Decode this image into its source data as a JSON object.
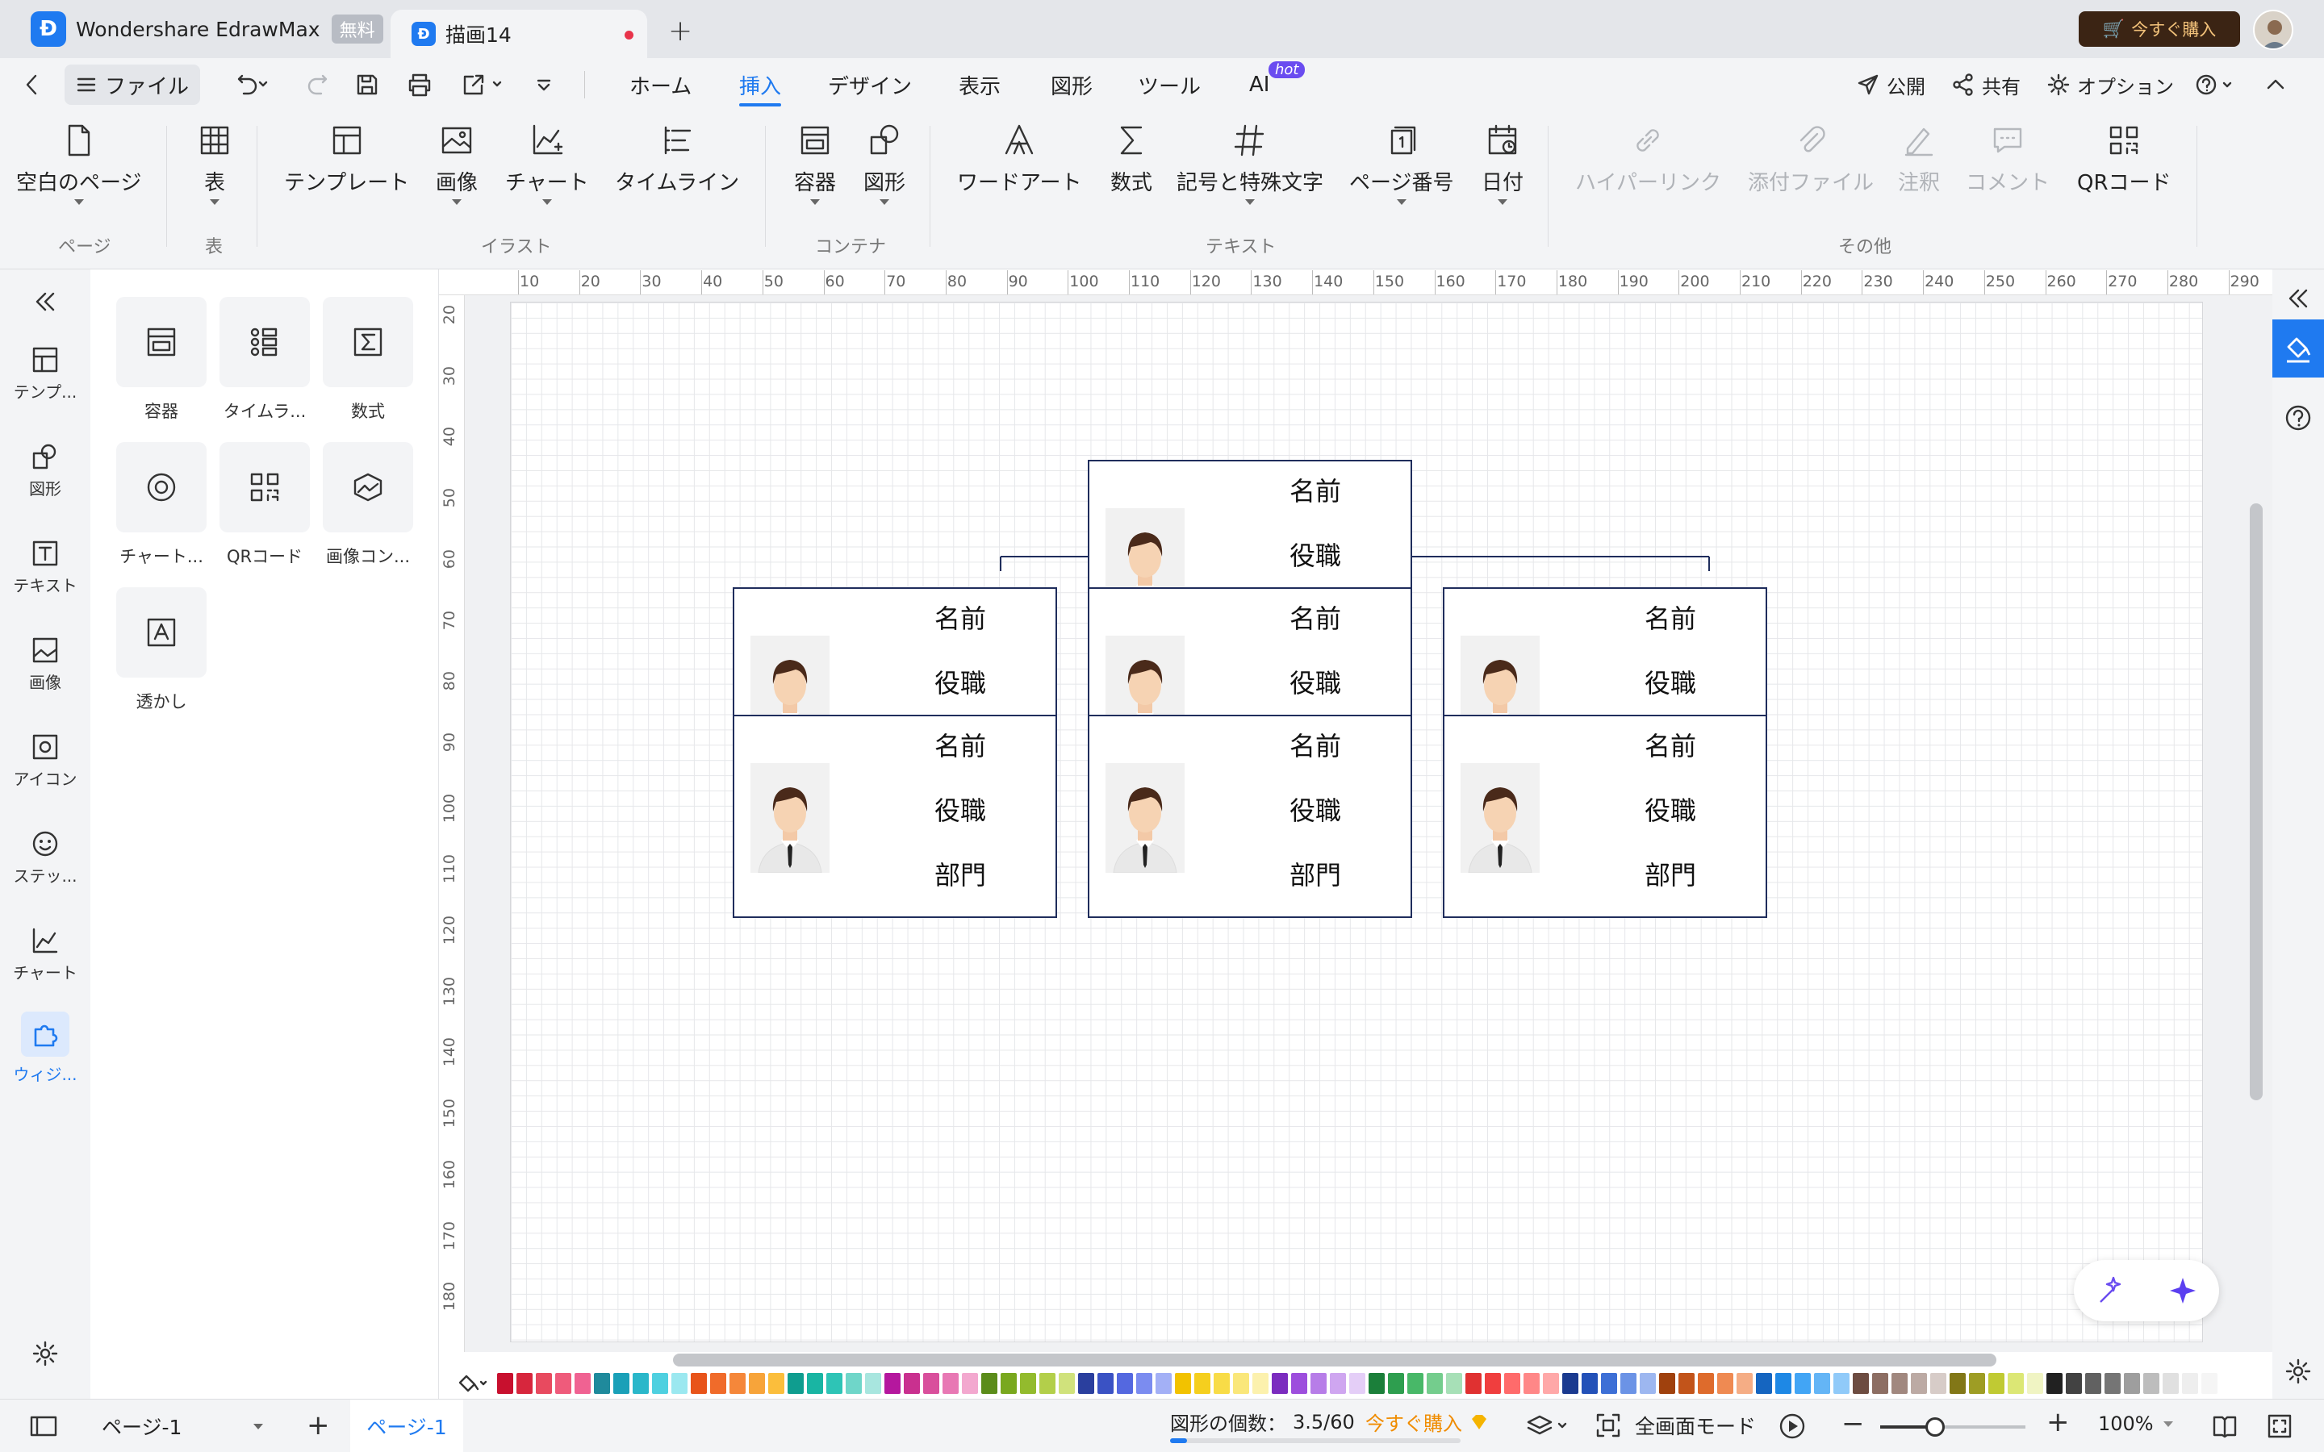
{
  "titlebar": {
    "app_title": "Wondershare EdrawMax",
    "free_badge": "無料",
    "doc_tab": "描画14",
    "buy_button": "今すぐ購入"
  },
  "menubar": {
    "file": "ファイル",
    "tabs": [
      "ホーム",
      "挿入",
      "デザイン",
      "表示",
      "図形",
      "ツール",
      "AI"
    ],
    "active_tab": "挿入",
    "hot_badge": "hot",
    "publish": "公開",
    "share": "共有",
    "options": "オプション"
  },
  "ribbon": {
    "buttons": {
      "blank_page": "空白のページ",
      "table": "表",
      "template": "テンプレート",
      "image": "画像",
      "chart": "チャート",
      "timeline": "タイムライン",
      "container": "容器",
      "shape": "図形",
      "wordart": "ワードアート",
      "formula": "数式",
      "symbols": "記号と特殊文字",
      "page_number": "ページ番号",
      "date": "日付",
      "hyperlink": "ハイパーリンク",
      "attachment": "添付ファイル",
      "note": "注釈",
      "comment": "コメント",
      "qrcode": "QRコード"
    },
    "groups": {
      "page": "ページ",
      "table": "表",
      "illust": "イラスト",
      "container": "コンテナ",
      "text": "テキスト",
      "other": "その他"
    }
  },
  "leftnav": [
    "テンプ...",
    "図形",
    "テキスト",
    "画像",
    "アイコン",
    "ステッ...",
    "チャート",
    "ウィジ..."
  ],
  "panel": [
    "容器",
    "タイムラ...",
    "数式",
    "チャート...",
    "QRコード",
    "画像コン...",
    "透かし"
  ],
  "ruler": {
    "h": [
      "10",
      "20",
      "30",
      "40",
      "50",
      "60",
      "70",
      "80",
      "90",
      "100",
      "110",
      "120",
      "130",
      "140",
      "150",
      "160",
      "170",
      "180",
      "190",
      "200",
      "210",
      "220",
      "230",
      "240",
      "250",
      "260",
      "270",
      "280",
      "290"
    ],
    "v": [
      "20",
      "30",
      "40",
      "50",
      "60",
      "70",
      "80",
      "90",
      "100",
      "110",
      "120",
      "130",
      "140",
      "150",
      "160",
      "170",
      "180"
    ]
  },
  "card": {
    "name": "名前",
    "title": "役職",
    "dept": "部門"
  },
  "bottombar": {
    "page_select": "ページ-1",
    "page_tab": "ページ-1",
    "shape_count_label": "図形の個数：",
    "shape_count": "3.5/60",
    "buy_link": "今すぐ購入",
    "fullscreen": "全画面モード",
    "zoom": "100%"
  },
  "colors": {
    "accent": "#1f7af0",
    "card_border": "#1f2d5c",
    "buy_bg": "#3b2414",
    "buy_text": "#f3c27a"
  },
  "palette": [
    "#c8102e",
    "#d7263d",
    "#e84a5f",
    "#ef5b7b",
    "#f06292",
    "#1f8a9c",
    "#1aa0b8",
    "#2ab7ca",
    "#4fd0e0",
    "#9be8f0",
    "#e8541a",
    "#f06b2a",
    "#f5873a",
    "#f7a43a",
    "#fbbe3c",
    "#0f9d8f",
    "#19b5a3",
    "#2ec4b6",
    "#6fd6c9",
    "#a8e6df",
    "#b5179e",
    "#c9308f",
    "#d94f9c",
    "#e878b4",
    "#f3a8cf",
    "#5b8c1a",
    "#79a81e",
    "#93bb2d",
    "#b3cf4a",
    "#d0e27c",
    "#2a3f9e",
    "#3a52c4",
    "#5468e0",
    "#7b8cf0",
    "#a3b0f6",
    "#f2c200",
    "#f5cf1e",
    "#f8dc47",
    "#fae77a",
    "#fcf1ad",
    "#7b2cbf",
    "#9d4edd",
    "#b77de8",
    "#cfa6f0",
    "#e4cef7",
    "#1b7f3a",
    "#2e9e4f",
    "#48b868",
    "#74cd8d",
    "#a7e0b7",
    "#e03131",
    "#f03e3e",
    "#ff6b6b",
    "#ff8787",
    "#ffa8a8",
    "#1a3a8f",
    "#2351b8",
    "#3d6fd6",
    "#6b93e6",
    "#9db7f0",
    "#a0410d",
    "#c2541a",
    "#de6b2c",
    "#ef8a52",
    "#f5ad85",
    "#1565c0",
    "#1e88e5",
    "#42a5f5",
    "#64b5f6",
    "#90caf9",
    "#6d4c41",
    "#8d6e63",
    "#a1887f",
    "#bcaaa4",
    "#d7ccc8",
    "#827717",
    "#9e9d24",
    "#c0ca33",
    "#dce775",
    "#f0f4c3",
    "#212121",
    "#424242",
    "#616161",
    "#757575",
    "#9e9e9e",
    "#bdbdbd",
    "#e0e0e0",
    "#eeeeee",
    "#f5f5f5"
  ]
}
